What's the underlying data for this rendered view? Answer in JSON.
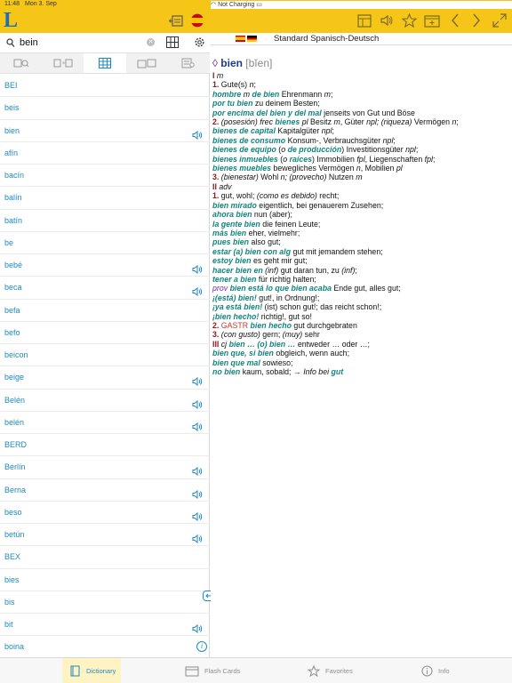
{
  "status_bar": {
    "time": "11:48",
    "date": "Mon 3. Sep",
    "battery": "Not Charging"
  },
  "app": {
    "logo": "L"
  },
  "search": {
    "query": "bein",
    "placeholder": ""
  },
  "word_list": [
    {
      "word": "BEI",
      "audio": false
    },
    {
      "word": "beis",
      "audio": false
    },
    {
      "word": "bien",
      "audio": true
    },
    {
      "word": "afín",
      "audio": false
    },
    {
      "word": "bacín",
      "audio": false
    },
    {
      "word": "balín",
      "audio": false
    },
    {
      "word": "batín",
      "audio": false
    },
    {
      "word": "be",
      "audio": false
    },
    {
      "word": "bebé",
      "audio": true
    },
    {
      "word": "beca",
      "audio": true
    },
    {
      "word": "befa",
      "audio": false
    },
    {
      "word": "befo",
      "audio": false
    },
    {
      "word": "beicon",
      "audio": false
    },
    {
      "word": "beige",
      "audio": true
    },
    {
      "word": "Belén",
      "audio": true
    },
    {
      "word": "belén",
      "audio": true
    },
    {
      "word": "BERD",
      "audio": false
    },
    {
      "word": "Berlín",
      "audio": true
    },
    {
      "word": "Berna",
      "audio": true
    },
    {
      "word": "beso",
      "audio": true
    },
    {
      "word": "betún",
      "audio": true
    },
    {
      "word": "BEX",
      "audio": false
    },
    {
      "word": "bies",
      "audio": false
    },
    {
      "word": "bis",
      "audio": false
    },
    {
      "word": "bit",
      "audio": true
    },
    {
      "word": "boina",
      "audio": false,
      "info": true
    }
  ],
  "dictionary": {
    "name": "Standard Spanisch-Deutsch"
  },
  "entry": {
    "lozenge": "◊",
    "headword": "bien",
    "pronunciation": "[bĭen]",
    "lines": [
      [
        [
          "roman",
          "I"
        ],
        [
          "it",
          " m"
        ]
      ],
      [
        [
          "num",
          "1."
        ],
        [
          "t",
          " Gute(s) "
        ],
        [
          "it",
          "n"
        ],
        [
          "t",
          ";"
        ]
      ],
      [
        [
          "ex",
          "hombre "
        ],
        [
          "it",
          "m "
        ],
        [
          "ex",
          "de bien"
        ],
        [
          "t",
          " Ehrenmann "
        ],
        [
          "it",
          "m"
        ],
        [
          "t",
          ";"
        ]
      ],
      [
        [
          "ex",
          "por tu bien"
        ],
        [
          "t",
          " zu deinem Besten;"
        ]
      ],
      [
        [
          "ex",
          "por encima del bien y del mal"
        ],
        [
          "t",
          " jenseits von Gut und Böse"
        ]
      ],
      [
        [
          "num",
          "2."
        ],
        [
          "it",
          " (posesión) frec "
        ],
        [
          "ex",
          "bienes"
        ],
        [
          "it",
          " pl"
        ],
        [
          "t",
          " Besitz "
        ],
        [
          "it",
          "m"
        ],
        [
          "t",
          ", Güter "
        ],
        [
          "it",
          "npl; (riqueza)"
        ],
        [
          "t",
          " Vermögen "
        ],
        [
          "it",
          "n"
        ],
        [
          "t",
          ";"
        ]
      ],
      [
        [
          "ex",
          "bienes de capital"
        ],
        [
          "t",
          " Kapitalgüter "
        ],
        [
          "it",
          "npl"
        ],
        [
          "t",
          ";"
        ]
      ],
      [
        [
          "ex",
          "bienes de consumo"
        ],
        [
          "t",
          " Konsum-, Verbrauchsgüter "
        ],
        [
          "it",
          "npl"
        ],
        [
          "t",
          ";"
        ]
      ],
      [
        [
          "ex",
          "bienes de equipo"
        ],
        [
          "t",
          " ("
        ],
        [
          "it",
          "o"
        ],
        [
          "t",
          " "
        ],
        [
          "ex",
          "de producción"
        ],
        [
          "t",
          ") Investitionsgüter "
        ],
        [
          "it",
          "npl"
        ],
        [
          "t",
          ";"
        ]
      ],
      [
        [
          "ex",
          "bienes inmuebles"
        ],
        [
          "t",
          " ("
        ],
        [
          "it",
          "o"
        ],
        [
          "t",
          " "
        ],
        [
          "ex",
          "raíces"
        ],
        [
          "t",
          ") Immobilien "
        ],
        [
          "it",
          "fpl"
        ],
        [
          "t",
          ", Liegenschaften "
        ],
        [
          "it",
          "fpl"
        ],
        [
          "t",
          ";"
        ]
      ],
      [
        [
          "ex",
          "bienes muebles"
        ],
        [
          "t",
          " bewegliches Vermögen "
        ],
        [
          "it",
          "n"
        ],
        [
          "t",
          ", Mobilien "
        ],
        [
          "it",
          "pl"
        ]
      ],
      [
        [
          "num",
          "3."
        ],
        [
          "it",
          " (bienestar)"
        ],
        [
          "t",
          " Wohl "
        ],
        [
          "it",
          "n; (provecho)"
        ],
        [
          "t",
          " Nutzen "
        ],
        [
          "it",
          "m"
        ]
      ],
      [
        [
          "roman",
          "II"
        ],
        [
          "it",
          " adv"
        ]
      ],
      [
        [
          "num",
          "1."
        ],
        [
          "t",
          " gut, wohl; "
        ],
        [
          "it",
          "(como es debido)"
        ],
        [
          "t",
          " recht;"
        ]
      ],
      [
        [
          "ex",
          "bien mirado"
        ],
        [
          "t",
          " eigentlich, bei genauerem Zusehen;"
        ]
      ],
      [
        [
          "ex",
          "ahora bien"
        ],
        [
          "t",
          " nun (aber);"
        ]
      ],
      [
        [
          "ex",
          "la gente bien"
        ],
        [
          "t",
          " die feinen Leute;"
        ]
      ],
      [
        [
          "ex",
          "más bien"
        ],
        [
          "t",
          " eher, vielmehr;"
        ]
      ],
      [
        [
          "ex",
          "pues bien"
        ],
        [
          "t",
          " also gut;"
        ]
      ],
      [
        [
          "ex",
          "estar (a) bien con alg"
        ],
        [
          "t",
          " gut mit jemandem stehen;"
        ]
      ],
      [
        [
          "ex",
          "estoy bien"
        ],
        [
          "t",
          " es geht mir gut;"
        ]
      ],
      [
        [
          "ex",
          "hacer bien en"
        ],
        [
          "it",
          " (inf)"
        ],
        [
          "t",
          " gut daran tun, zu "
        ],
        [
          "it",
          "(inf)"
        ],
        [
          "t",
          ";"
        ]
      ],
      [
        [
          "ex",
          "tener a bien"
        ],
        [
          "t",
          " für richtig halten;"
        ]
      ],
      [
        [
          "reg",
          "prov "
        ],
        [
          "ex",
          "bien está lo que bien acaba"
        ],
        [
          "t",
          " Ende gut, alles gut;"
        ]
      ],
      [
        [
          "ex",
          "¡(está) bien!"
        ],
        [
          "t",
          " gut!, in Ordnung!;"
        ]
      ],
      [
        [
          "ex",
          "¡ya está bien!"
        ],
        [
          "t",
          " (ist) schon gut!; das reicht schon!;"
        ]
      ],
      [
        [
          "ex",
          "¡bien hecho!"
        ],
        [
          "t",
          " richtig!, gut so!"
        ]
      ],
      [
        [
          "num",
          "2."
        ],
        [
          "field",
          " GASTR "
        ],
        [
          "ex",
          "bien hecho"
        ],
        [
          "t",
          " gut durchgebraten"
        ]
      ],
      [
        [
          "num",
          "3."
        ],
        [
          "it",
          " (con gusto)"
        ],
        [
          "t",
          " gern; "
        ],
        [
          "it",
          "(muy)"
        ],
        [
          "t",
          " sehr"
        ]
      ],
      [
        [
          "roman",
          "III"
        ],
        [
          "it",
          " cj "
        ],
        [
          "ex",
          "bien … (o) bien …"
        ],
        [
          "t",
          " entweder … oder …;"
        ]
      ],
      [
        [
          "ex",
          "bien que, si bien"
        ],
        [
          "t",
          " obgleich, wenn auch;"
        ]
      ],
      [
        [
          "ex",
          "bien que mal"
        ],
        [
          "t",
          " sowieso;"
        ]
      ],
      [
        [
          "ex",
          "no bien"
        ],
        [
          "t",
          " kaum, sobald; → "
        ],
        [
          "it",
          "Info bei "
        ],
        [
          "ref",
          "gut"
        ]
      ]
    ]
  },
  "tabs": [
    {
      "label": "Dictionary",
      "icon": "book-icon",
      "active": true
    },
    {
      "label": "Flash Cards",
      "icon": "cards-icon",
      "active": false
    },
    {
      "label": "Favorites",
      "icon": "star-icon",
      "active": false
    },
    {
      "label": "Info",
      "icon": "info-icon",
      "active": false
    }
  ],
  "colors": {
    "accent": "#f5c518",
    "link": "#1d8ac0",
    "example": "#12857d",
    "headword": "#1b3b8f"
  }
}
